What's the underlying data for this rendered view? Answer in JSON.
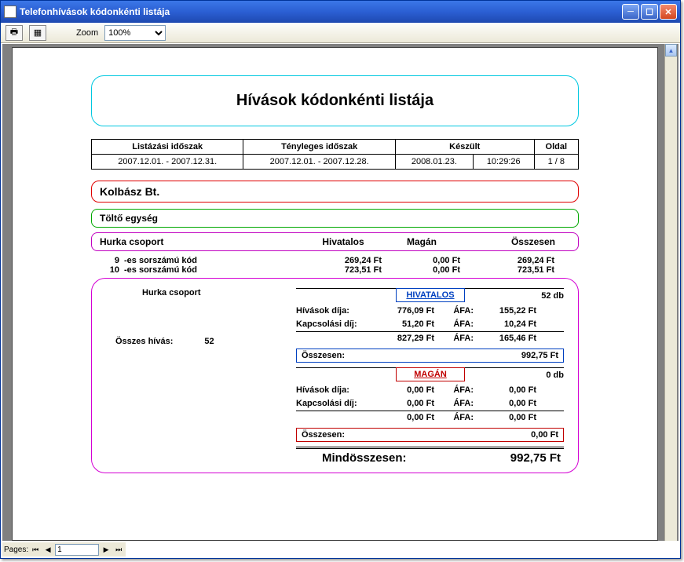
{
  "window": {
    "title": "Telefonhívások kódonkénti listája"
  },
  "toolbar": {
    "zoom_label": "Zoom",
    "zoom_value": "100%"
  },
  "report": {
    "title": "Hívások kódonkénti listája",
    "info_headers": {
      "list_period": "Listázási időszak",
      "actual_period": "Tényleges időszak",
      "created": "Készült",
      "page": "Oldal"
    },
    "info_values": {
      "list_period": "2007.12.01. - 2007.12.31.",
      "actual_period": "2007.12.01. - 2007.12.28.",
      "created_date": "2008.01.23.",
      "created_time": "10:29:26",
      "page": "1 / 8"
    },
    "company": "Kolbász Bt.",
    "unit": "Töltő egység",
    "group_header": {
      "name": "Hurka csoport",
      "official": "Hivatalos",
      "private": "Magán",
      "total": "Összesen"
    },
    "rows": [
      {
        "num": "9",
        "label": "-es sorszámú kód",
        "official": "269,24 Ft",
        "private": "0,00 Ft",
        "total": "269,24 Ft"
      },
      {
        "num": "10",
        "label": "-es sorszámú kód",
        "official": "723,51 Ft",
        "private": "0,00 Ft",
        "total": "723,51 Ft"
      }
    ],
    "summary": {
      "group_name": "Hurka csoport",
      "total_calls_label": "Összes hívás:",
      "total_calls": "52",
      "sections": [
        {
          "badge": "HIVATALOS",
          "badge_class": "blue",
          "count": "52 db",
          "call_fee_label": "Hívások díja:",
          "call_fee": "776,09 Ft",
          "call_vat": "155,22 Ft",
          "conn_fee_label": "Kapcsolási díj:",
          "conn_fee": "51,20 Ft",
          "conn_vat": "10,24 Ft",
          "subtotal": "827,29 Ft",
          "subtotal_vat": "165,46 Ft",
          "vat_label": "ÁFA:",
          "total_label": "Összesen:",
          "total": "992,75 Ft"
        },
        {
          "badge": "MAGÁN",
          "badge_class": "red",
          "count": "0 db",
          "call_fee_label": "Hívások díja:",
          "call_fee": "0,00 Ft",
          "call_vat": "0,00 Ft",
          "conn_fee_label": "Kapcsolási díj:",
          "conn_fee": "0,00 Ft",
          "conn_vat": "0,00 Ft",
          "subtotal": "0,00 Ft",
          "subtotal_vat": "0,00 Ft",
          "vat_label": "ÁFA:",
          "total_label": "Összesen:",
          "total": "0,00 Ft"
        }
      ],
      "grand_label": "Mindösszesen:",
      "grand_total": "992,75 Ft"
    }
  },
  "pager": {
    "label": "Pages:",
    "current": "1"
  }
}
